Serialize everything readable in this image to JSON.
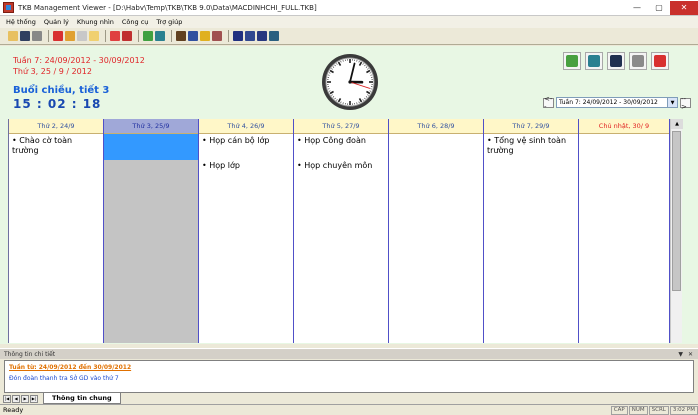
{
  "window": {
    "title": "TKB Management Viewer - [D:\\Habv\\Temp\\TKB\\TKB 9.0\\Data\\MACDINHCHI_FULL.TKB]",
    "min": "—",
    "max": "▢",
    "close": "✕"
  },
  "menu": {
    "items": [
      "Hệ thống",
      "Quản lý",
      "Khung nhìn",
      "Công cụ",
      "Trợ giúp"
    ]
  },
  "header": {
    "week_range": "Tuần 7: 24/09/2012 - 30/09/2012",
    "current_date": "Thứ 3, 25 / 9 / 2012",
    "session": "Buổi chiều, tiết 3",
    "time": "15 : 02 : 18"
  },
  "week_nav": {
    "prev": "<--",
    "selected": "Tuần 7: 24/09/2012 - 30/09/2012",
    "next": "-->"
  },
  "colors": {
    "accent_red": "#e0262a",
    "accent_blue": "#1860d8",
    "grid_line": "#5050c8",
    "header_bg": "#fff7c8",
    "selection": "#3399ff"
  },
  "days": [
    {
      "label": "Thứ 2, 24/9",
      "events": [
        "Chào cờ toàn trường"
      ]
    },
    {
      "label": "Thứ 3, 25/9",
      "events": []
    },
    {
      "label": "Thứ 4, 26/9",
      "events": [
        "Họp cán bộ lớp",
        "Họp lớp"
      ]
    },
    {
      "label": "Thứ 5, 27/9",
      "events": [
        "Họp Công đoàn",
        "Họp chuyên môn"
      ]
    },
    {
      "label": "Thứ 6, 28/9",
      "events": []
    },
    {
      "label": "Thứ 7, 29/9",
      "events": [
        "Tổng vệ sinh toàn trường"
      ]
    },
    {
      "label": "Chủ nhật, 30/ 9",
      "events": []
    }
  ],
  "detail": {
    "header": "Thông tin chi tiết",
    "pin": "▼",
    "close": "✕",
    "line1": "Tuần từ: 24/09/2012 đến 30/09/2012",
    "line2": "Đón đoàn thanh tra Sở GD vào thứ 7"
  },
  "sheet": {
    "nav": [
      "|◀",
      "◀",
      "▶",
      "▶|"
    ],
    "tab": "Thông tin chung"
  },
  "status": {
    "ready": "Ready",
    "caps": "CAP",
    "num": "NUM",
    "scrl": "SCRL",
    "clock": "3:02 PM"
  },
  "clock": {
    "hour": 3,
    "minute": 2,
    "second": 18
  }
}
